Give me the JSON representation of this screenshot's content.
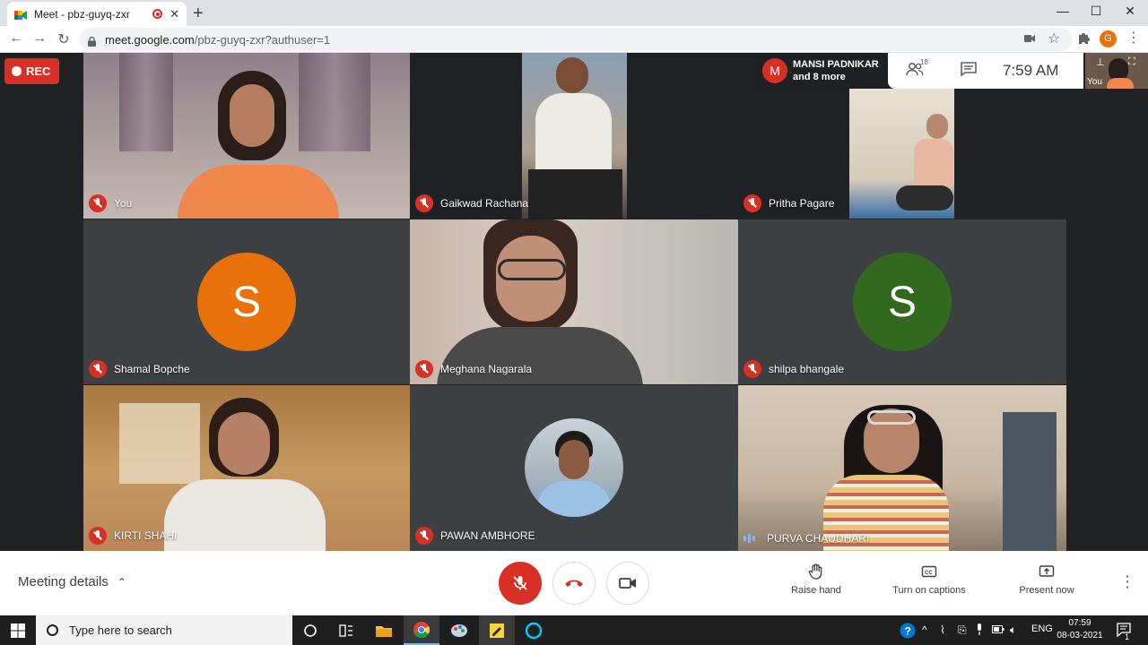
{
  "browser": {
    "tab_title": "Meet - pbz-guyq-zxr",
    "close_glyph": "✕",
    "new_tab_glyph": "+",
    "url_host": "meet.google.com",
    "url_path": "/pbz-guyq-zxr?authuser=1",
    "profile_initial": "G",
    "window_controls": {
      "minimize": "—",
      "maximize": "☐",
      "close": "✕"
    }
  },
  "meet": {
    "rec_label": "REC",
    "participants_pill": {
      "avatar_initial": "M",
      "name": "MANSI PADNIKAR",
      "more": "and 8 more"
    },
    "people_count": "18",
    "clock": "7:59 AM",
    "self_label": "You",
    "tiles": [
      {
        "name": "You",
        "mic": "off"
      },
      {
        "name": "Gaikwad Rachana",
        "mic": "off"
      },
      {
        "name": "Pritha Pagare",
        "mic": "off"
      },
      {
        "name": "Shamal Bopche",
        "mic": "off",
        "avatar_initial": "S",
        "avatar_color": "#e8710a"
      },
      {
        "name": "Meghana Nagarala",
        "mic": "off"
      },
      {
        "name": "shilpa bhangale",
        "mic": "off",
        "avatar_initial": "S",
        "avatar_color": "#33691e"
      },
      {
        "name": "KIRTI SHAHI",
        "mic": "off"
      },
      {
        "name": "PAWAN AMBHORE",
        "mic": "off"
      },
      {
        "name": "PURVA CHAUDHARI",
        "mic": "on"
      }
    ]
  },
  "bottom": {
    "meeting_details": "Meeting details",
    "raise_hand": "Raise hand",
    "captions": "Turn on captions",
    "present": "Present now"
  },
  "taskbar": {
    "search_placeholder": "Type here to search",
    "lang": "ENG",
    "time": "07:59",
    "date": "08-03-2021",
    "notification_count": "1"
  },
  "colors": {
    "meet_bg": "#202124",
    "rec_red": "#d93025",
    "accent_blue": "#8ab4f8"
  }
}
